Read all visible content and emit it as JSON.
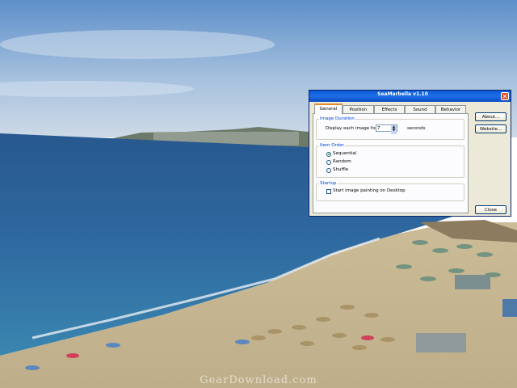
{
  "dialog": {
    "title": "SeaMarbella v1.10",
    "close_glyph": "✕",
    "tabs": [
      "General",
      "Position",
      "Effects",
      "Sound",
      "Behavior"
    ],
    "image_duration": {
      "group_title": "Image Duration",
      "label": "Display each image for",
      "value": "7",
      "unit": "seconds"
    },
    "item_order": {
      "group_title": "Item Order",
      "options": [
        "Sequential",
        "Random",
        "Shuffle"
      ],
      "selected": "Sequential"
    },
    "startup": {
      "group_title": "Startup",
      "checkbox_label": "Start image painting on Desktop"
    },
    "buttons": {
      "about": "About...",
      "website": "Website...",
      "close": "Close"
    }
  },
  "watermark": "GearDownload.com",
  "icons": [
    "close-icon",
    "spin-up-icon",
    "spin-down-icon"
  ]
}
